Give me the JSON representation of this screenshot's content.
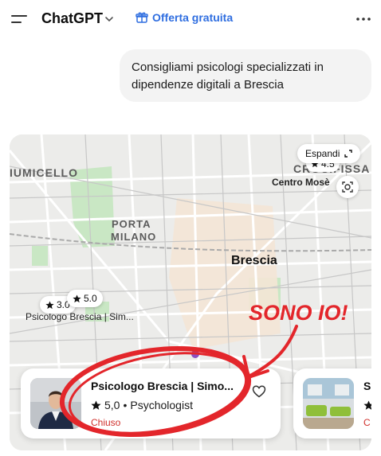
{
  "header": {
    "app_title": "ChatGPT",
    "offer_label": "Offerta gratuita",
    "accent_color": "#2f6ee0"
  },
  "conversation": {
    "user_message": "Consigliami psicologi specializzati in dipendenze digitali a Brescia"
  },
  "map": {
    "expand_label": "Espandi",
    "labels": {
      "area_left": "IUMICELLO",
      "area_right": "CROCIFISSA",
      "porta_line1": "PORTA",
      "porta_line2": "MILANO",
      "city": "Brescia",
      "poi_right": "Centro Mosè",
      "poi_left": "Psicologo Brescia | Sim..."
    },
    "pills": [
      {
        "rating": "3.0"
      },
      {
        "rating": "5.0"
      },
      {
        "rating": "4.5"
      }
    ]
  },
  "results": [
    {
      "name": "Psicologo Brescia | Simo...",
      "rating": "5,0",
      "category": "Psychologist",
      "status": "Chiuso",
      "status_color": "#d0312d"
    },
    {
      "name": "Sp",
      "status": "C"
    }
  ],
  "annotation": {
    "text": "SONO IO!",
    "color": "#e3262b"
  }
}
